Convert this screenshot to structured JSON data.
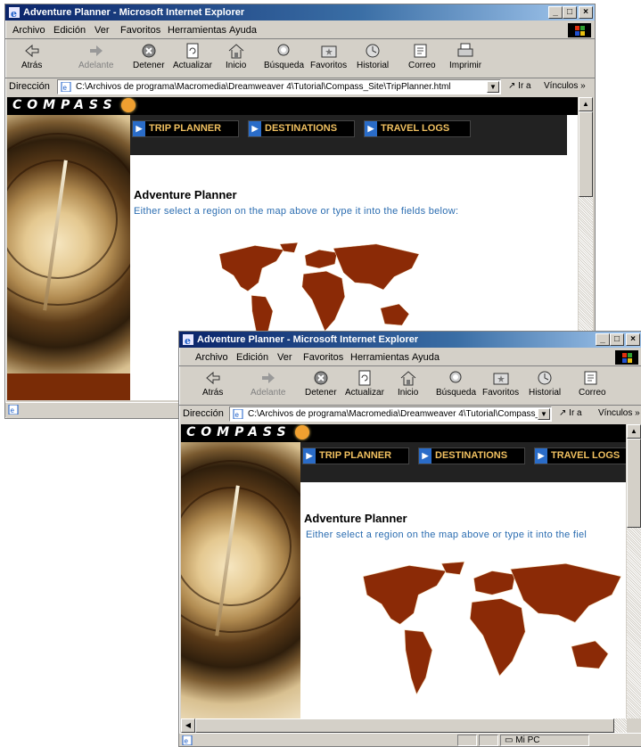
{
  "window": {
    "title": "Adventure Planner - Microsoft Internet Explorer",
    "buttons": {
      "minimize": "_",
      "maximize": "□",
      "close": "×"
    }
  },
  "menu": {
    "items": [
      "Archivo",
      "Edición",
      "Ver",
      "Favoritos",
      "Herramientas",
      "Ayuda"
    ]
  },
  "toolbar": {
    "back": "Atrás",
    "forward": "Adelante",
    "stop": "Detener",
    "refresh": "Actualizar",
    "home": "Inicio",
    "search": "Búsqueda",
    "favorites": "Favoritos",
    "history": "Historial",
    "mail": "Correo",
    "print": "Imprimir"
  },
  "address": {
    "label": "Dirección",
    "url_full": "C:\\Archivos de programa\\Macromedia\\Dreamweaver 4\\Tutorial\\Compass_Site\\TripPlanner.html",
    "url_truncated": "C:\\Archivos de programa\\Macromedia\\Dreamweaver 4\\Tutorial\\Compass_Si",
    "go": "Ir a",
    "links": "Vínculos"
  },
  "site": {
    "logo": "COMPASS",
    "nav": [
      "TRIP PLANNER",
      "DESTINATIONS",
      "TRAVEL LOGS"
    ],
    "page_title": "Adventure Planner",
    "page_subtitle": "Either select a region on the map above or type it into the fields below:",
    "page_subtitle_cut": "Either select a region on the map above or type it into the fiel"
  },
  "status": {
    "zone": "Mi PC"
  },
  "colors": {
    "title_bar": "#0a246a",
    "map_land": "#8b2a06",
    "nav_text": "#f0c060",
    "subtitle": "#2a6cb0"
  }
}
